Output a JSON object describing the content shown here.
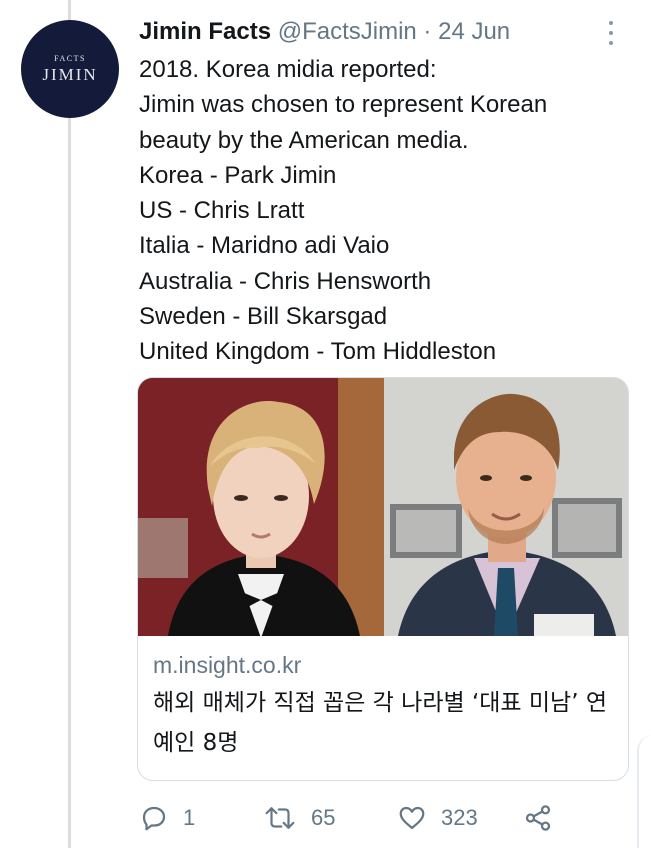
{
  "tweet": {
    "avatar": {
      "small_text": "FACTS",
      "big_text": "JIMIN",
      "bg_color": "#131a3a"
    },
    "author_name": "Jimin Facts",
    "author_handle": "@FactsJimin",
    "separator": " · ",
    "date": "24 Jun",
    "more_icon": "more-vertical-icon",
    "text_lines": [
      "2018. Korea midia reported:",
      "Jimin was chosen to represent Korean",
      "beauty by the American media.",
      "Korea - Park Jimin",
      "US - Chris Lratt",
      "Italia - Maridno adi Vaio",
      "Australia - Chris Hensworth",
      "Sweden - Bill Skarsgad",
      "United Kingdom - Tom Hiddleston"
    ],
    "card": {
      "domain": "m.insight.co.kr",
      "title": "해외 매체가 직접 꼽은 각 나라별 ‘대표 미남’ 연예인 8명"
    },
    "actions": {
      "reply_count": "1",
      "retweet_count": "65",
      "like_count": "323"
    }
  },
  "colors": {
    "text": "#14171a",
    "secondary": "#657786",
    "border": "#d6dde3"
  }
}
